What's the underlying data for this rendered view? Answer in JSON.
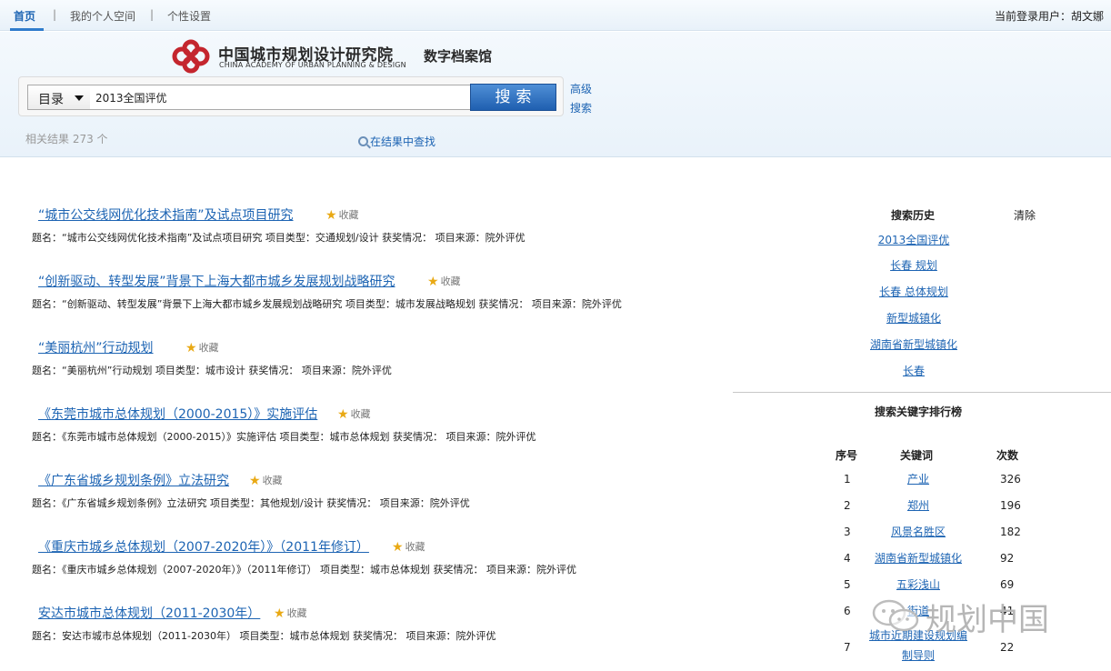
{
  "nav": {
    "items": [
      "首页",
      "我的个人空间",
      "个性设置"
    ],
    "separator": "|",
    "login_text": "当前登录用户：胡文娜"
  },
  "logo": {
    "cn": "中国城市规划设计研究院",
    "en": "CHINA ACADEMY OF URBAN PLANNING & DESIGN",
    "sub": "数字档案馆"
  },
  "search": {
    "scope": "目录",
    "query": "2013全国评优",
    "button": "搜索",
    "advanced": "高级搜索"
  },
  "result_count": "相关结果  273  个",
  "search_within": "在结果中查找",
  "fav_label": "收藏",
  "results": [
    {
      "title": "“城市公交线网优化技术指南”及试点项目研究",
      "desc": "题名：“城市公交线网优化技术指南”及试点项目研究  项目类型：交通规划/设计  获奖情况：  项目来源：院外评优"
    },
    {
      "title": "“创新驱动、转型发展”背景下上海大都市城乡发展规划战略研究",
      "desc": "题名：“创新驱动、转型发展”背景下上海大都市城乡发展规划战略研究  项目类型：城市发展战略规划  获奖情况：  项目来源：院外评优"
    },
    {
      "title": "“美丽杭州”行动规划",
      "desc": "题名：“美丽杭州”行动规划  项目类型：城市设计  获奖情况：  项目来源：院外评优"
    },
    {
      "title": "《东莞市城市总体规划（2000-2015）》实施评估",
      "desc": "题名：《东莞市城市总体规划（2000-2015）》实施评估  项目类型：城市总体规划  获奖情况：  项目来源：院外评优"
    },
    {
      "title": "《广东省城乡规划条例》立法研究",
      "desc": "题名：《广东省城乡规划条例》立法研究  项目类型：其他规划/设计  获奖情况：  项目来源：院外评优"
    },
    {
      "title": "《重庆市城乡总体规划（2007-2020年）》（2011年修订）",
      "desc": "题名：《重庆市城乡总体规划（2007-2020年）》（2011年修订）  项目类型：城市总体规划  获奖情况：  项目来源：院外评优"
    },
    {
      "title": "安达市城市总体规划（2011-2030年）",
      "desc": "题名：安达市城市总体规划（2011-2030年）  项目类型：城市总体规划  获奖情况：  项目来源：院外评优"
    }
  ],
  "history": {
    "title": "搜索历史",
    "clear": "清除",
    "items": [
      "2013全国评优",
      "长春 规划",
      "长春 总体规划",
      "新型城镇化",
      "湖南省新型城镇化",
      "长春"
    ]
  },
  "ranking": {
    "title": "搜索关键字排行榜",
    "headers": [
      "序号",
      "关键词",
      "次数"
    ],
    "rows": [
      {
        "no": "1",
        "kw": "产业",
        "count": "326"
      },
      {
        "no": "2",
        "kw": "郑州",
        "count": "196"
      },
      {
        "no": "3",
        "kw": "风景名胜区",
        "count": "182"
      },
      {
        "no": "4",
        "kw": "湖南省新型城镇化",
        "count": "92"
      },
      {
        "no": "5",
        "kw": "五彩浅山",
        "count": "69"
      },
      {
        "no": "6",
        "kw": "街道",
        "count": "41"
      },
      {
        "no": "7",
        "kw": "城市近期建设规划编制导则",
        "count": "22"
      }
    ]
  },
  "watermark": "规划中国",
  "colors": {
    "link": "#1d64b3",
    "button": "#2f6fbf",
    "star": "#e9a914",
    "logo_red": "#c4262e"
  }
}
